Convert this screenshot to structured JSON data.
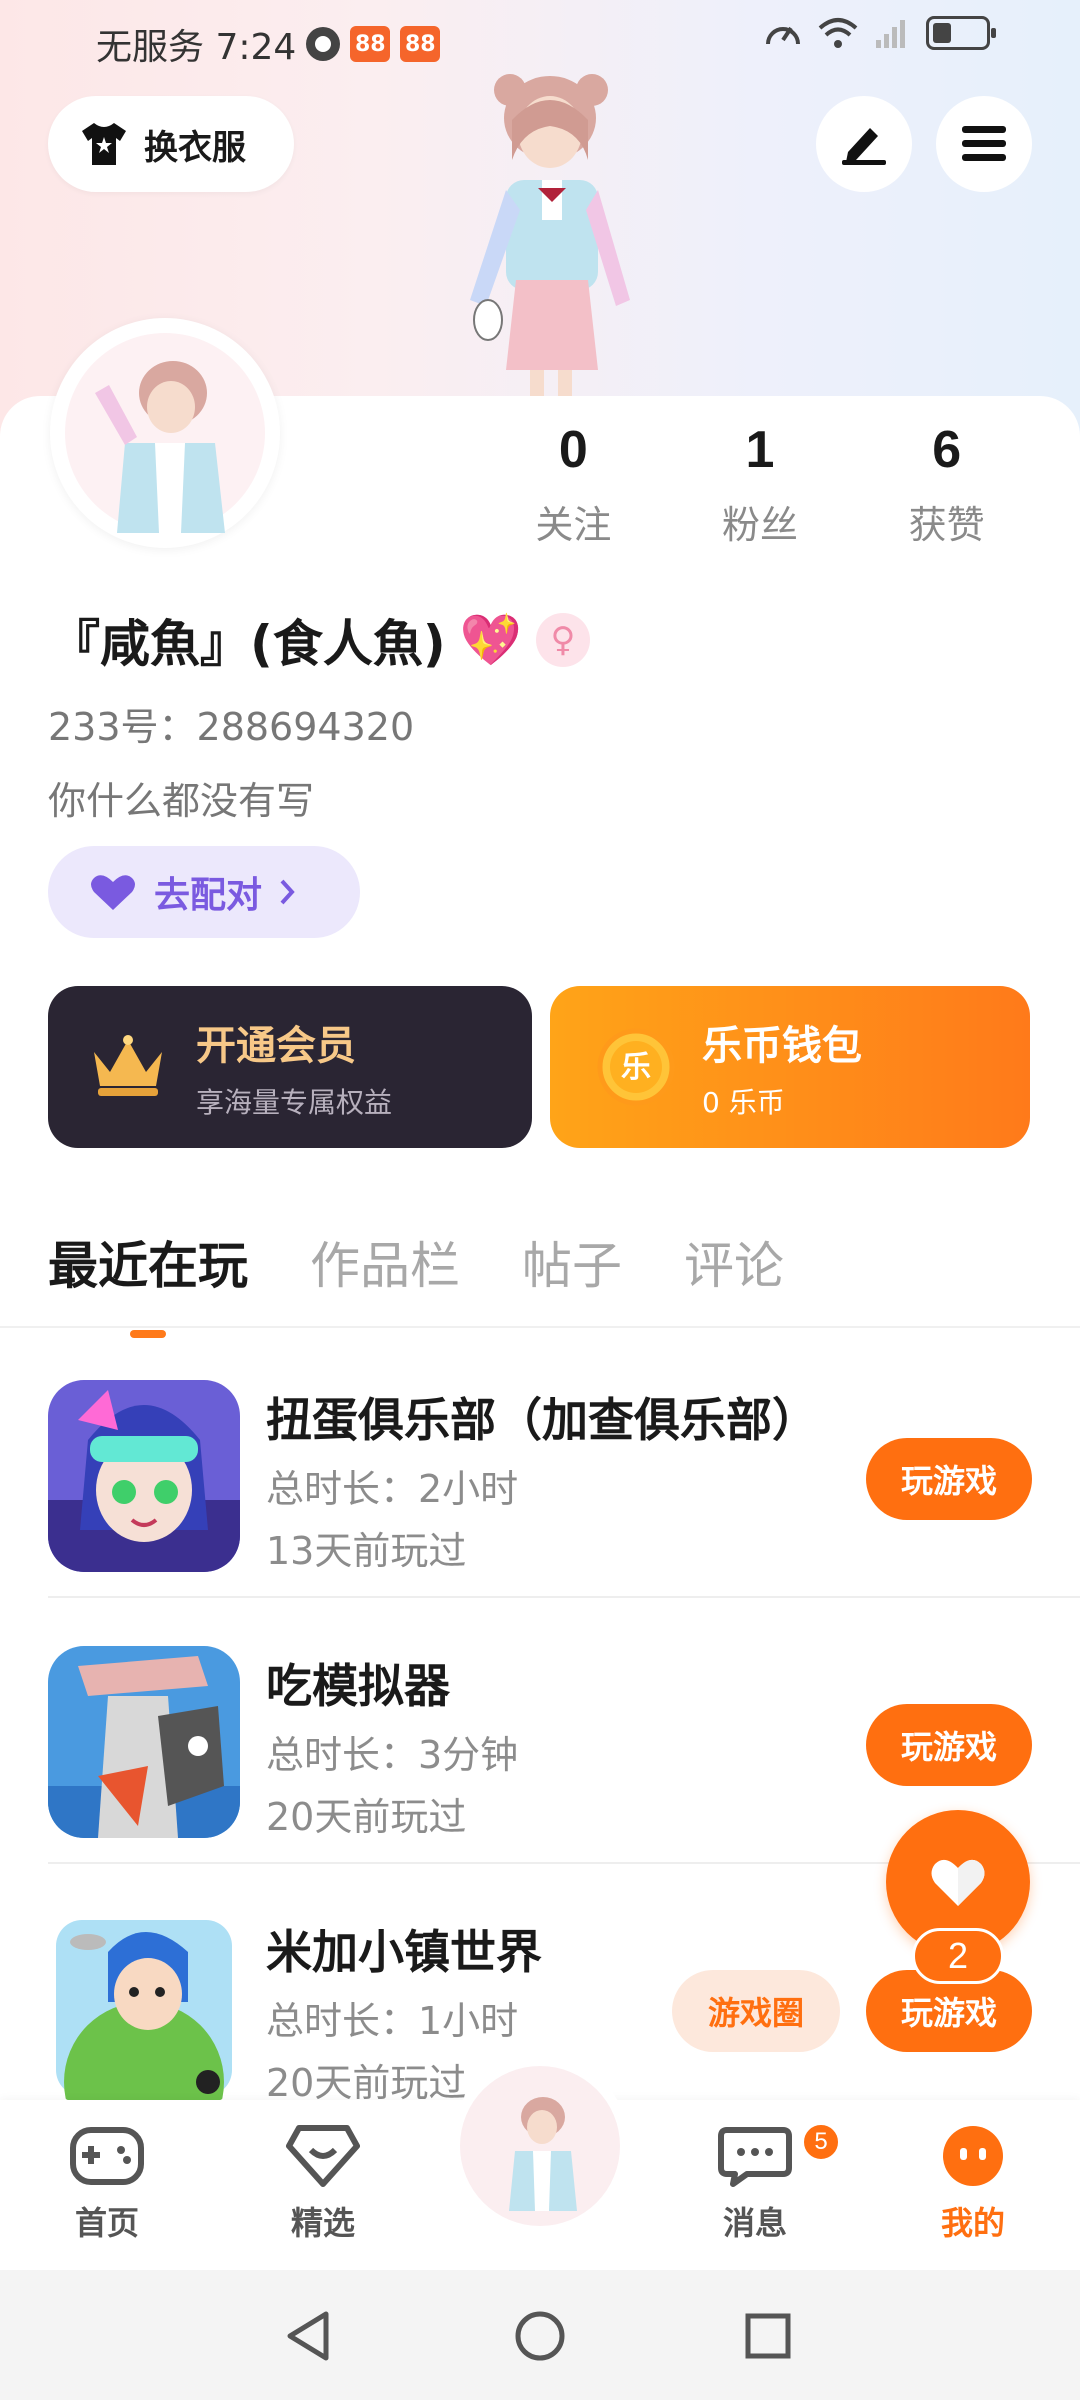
{
  "status_bar": {
    "carrier_time": "无服务 7:24",
    "app_badges": [
      "app-badge-icon",
      "app-badge-icon"
    ]
  },
  "header": {
    "dress_label": "换衣服"
  },
  "profile": {
    "stats": [
      {
        "value": "0",
        "label": "关注"
      },
      {
        "value": "1",
        "label": "粉丝"
      },
      {
        "value": "6",
        "label": "获赞"
      }
    ],
    "nickname": "『咸魚』(食人魚)",
    "nickname_emoji": "💖",
    "gender_symbol": "♀",
    "user_id": "233号：288694320",
    "bio": "你什么都没有写",
    "match_label": "去配对"
  },
  "cards": {
    "vip": {
      "title": "开通会员",
      "subtitle": "享海量专属权益"
    },
    "wallet": {
      "title": "乐币钱包",
      "subtitle": "0 乐币",
      "coin_char": "乐"
    }
  },
  "tabs": [
    "最近在玩",
    "作品栏",
    "帖子",
    "评论"
  ],
  "games": [
    {
      "name": "扭蛋俱乐部（加查俱乐部）",
      "duration": "总时长：2小时",
      "last_played": "13天前玩过",
      "play_label": "玩游戏"
    },
    {
      "name": "吃模拟器",
      "duration": "总时长：3分钟",
      "last_played": "20天前玩过",
      "play_label": "玩游戏"
    },
    {
      "name": "米加小镇世界",
      "duration": "总时长：1小时",
      "last_played": "20天前玩过",
      "play_label": "玩游戏",
      "circle_label": "游戏圈"
    }
  ],
  "float_like": {
    "count": "2"
  },
  "bottom_nav": {
    "home": "首页",
    "featured": "精选",
    "messages": "消息",
    "messages_badge": "5",
    "mine": "我的"
  },
  "colors": {
    "accent": "#ff6f10",
    "vip_bg": "#2a2533",
    "match_bg": "#ece8fc",
    "match_text": "#7a5ae0"
  }
}
